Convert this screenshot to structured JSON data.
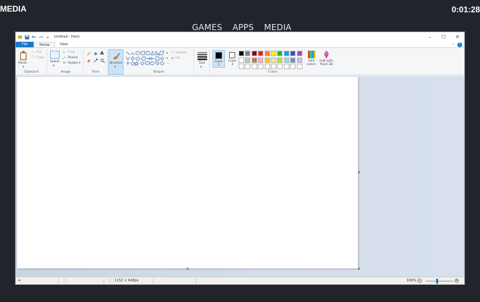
{
  "console": {
    "left_label": "MEDIA",
    "clock": "0:01:28",
    "nav": [
      "GAMES",
      "APPS",
      "MEDIA"
    ]
  },
  "window": {
    "title": "Untitled - Paint",
    "controls": {
      "minimize": "–",
      "maximize": "☐",
      "close": "✕"
    }
  },
  "tabs": {
    "file": "File",
    "home": "Home",
    "view": "View"
  },
  "ribbon": {
    "clipboard": {
      "label": "Clipboard",
      "paste": "Paste",
      "cut": "Cut",
      "copy": "Copy"
    },
    "image": {
      "label": "Image",
      "select": "Select",
      "crop": "Crop",
      "resize": "Resize",
      "rotate": "Rotate"
    },
    "tools": {
      "label": "Tools"
    },
    "brushes": {
      "label": "Brushes"
    },
    "shapes": {
      "label": "Shapes",
      "outline": "Outline",
      "fill": "Fill"
    },
    "size": {
      "label": "Size"
    },
    "colors": {
      "label": "Colors",
      "color1": "Color 1",
      "color2": "Color 2",
      "edit_colors": "Edit colors",
      "edit_3d": "Edit with Paint 3D",
      "row1": [
        "#000000",
        "#7f7f7f",
        "#880015",
        "#ed1c24",
        "#ff7f27",
        "#fff200",
        "#22b14c",
        "#00a2e8",
        "#3f48cc",
        "#a349a4"
      ],
      "row2": [
        "#ffffff",
        "#c3c3c3",
        "#b97a57",
        "#ffaec9",
        "#ffc90e",
        "#efe4b0",
        "#b5e61d",
        "#99d9ea",
        "#7092be",
        "#c8bfe7"
      ],
      "row3": [
        "#ffffff",
        "#ffffff",
        "#ffffff",
        "#ffffff",
        "#ffffff",
        "#ffffff",
        "#ffffff",
        "#ffffff",
        "#ffffff",
        "#ffffff"
      ]
    }
  },
  "status": {
    "dimensions": "1152 × 648px",
    "zoom": "100%"
  }
}
